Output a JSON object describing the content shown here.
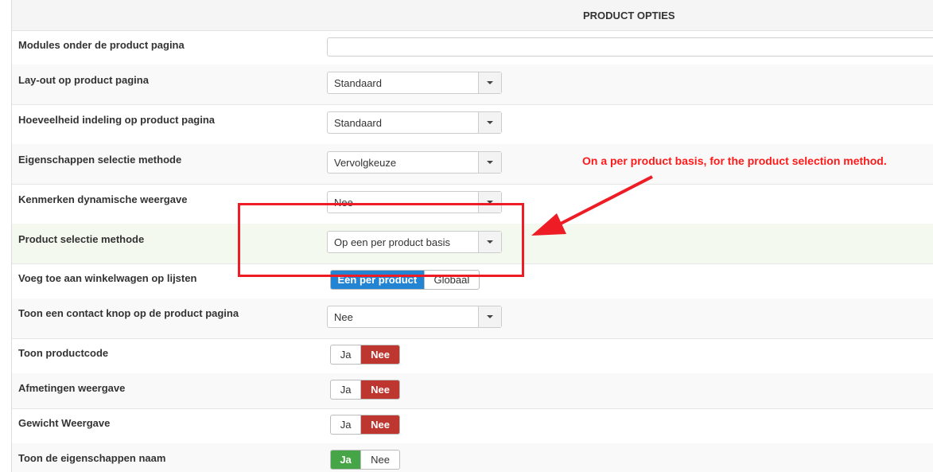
{
  "section": {
    "title": "PRODUCT OPTIES"
  },
  "rows": [
    {
      "label": "Modules onder de product pagina",
      "value": ""
    },
    {
      "label": "Lay-out op product pagina",
      "value": "Standaard"
    },
    {
      "label": "Hoeveelheid indeling op product pagina",
      "value": "Standaard"
    },
    {
      "label": "Eigenschappen selectie methode",
      "value": "Vervolgkeuze"
    },
    {
      "label": "Kenmerken dynamische weergave",
      "value": "Nee"
    },
    {
      "label": "Product selectie methode",
      "value": "Op een per product basis"
    },
    {
      "label": "Voeg toe aan winkelwagen op lijsten",
      "options": [
        "Eén per product",
        "Globaal"
      ],
      "selected": "Eén per product"
    },
    {
      "label": "Toon een contact knop op de product pagina",
      "value": "Nee"
    },
    {
      "label": "Toon productcode",
      "options": [
        "Ja",
        "Nee"
      ],
      "selected": "Nee"
    },
    {
      "label": "Afmetingen weergave",
      "options": [
        "Ja",
        "Nee"
      ],
      "selected": "Nee"
    },
    {
      "label": "Gewicht Weergave",
      "options": [
        "Ja",
        "Nee"
      ],
      "selected": "Nee"
    },
    {
      "label": "Toon de eigenschappen naam",
      "options": [
        "Ja",
        "Nee"
      ],
      "selected": "Ja"
    }
  ],
  "annotation": {
    "text": "On a per product basis, for the product selection method.",
    "color": "#ee1c25"
  },
  "colors": {
    "no_active": "#bd362f",
    "yes_active": "#46a546",
    "choice_active": "#2384d3"
  },
  "icons": {
    "select_caret": "chevron-down-icon"
  }
}
